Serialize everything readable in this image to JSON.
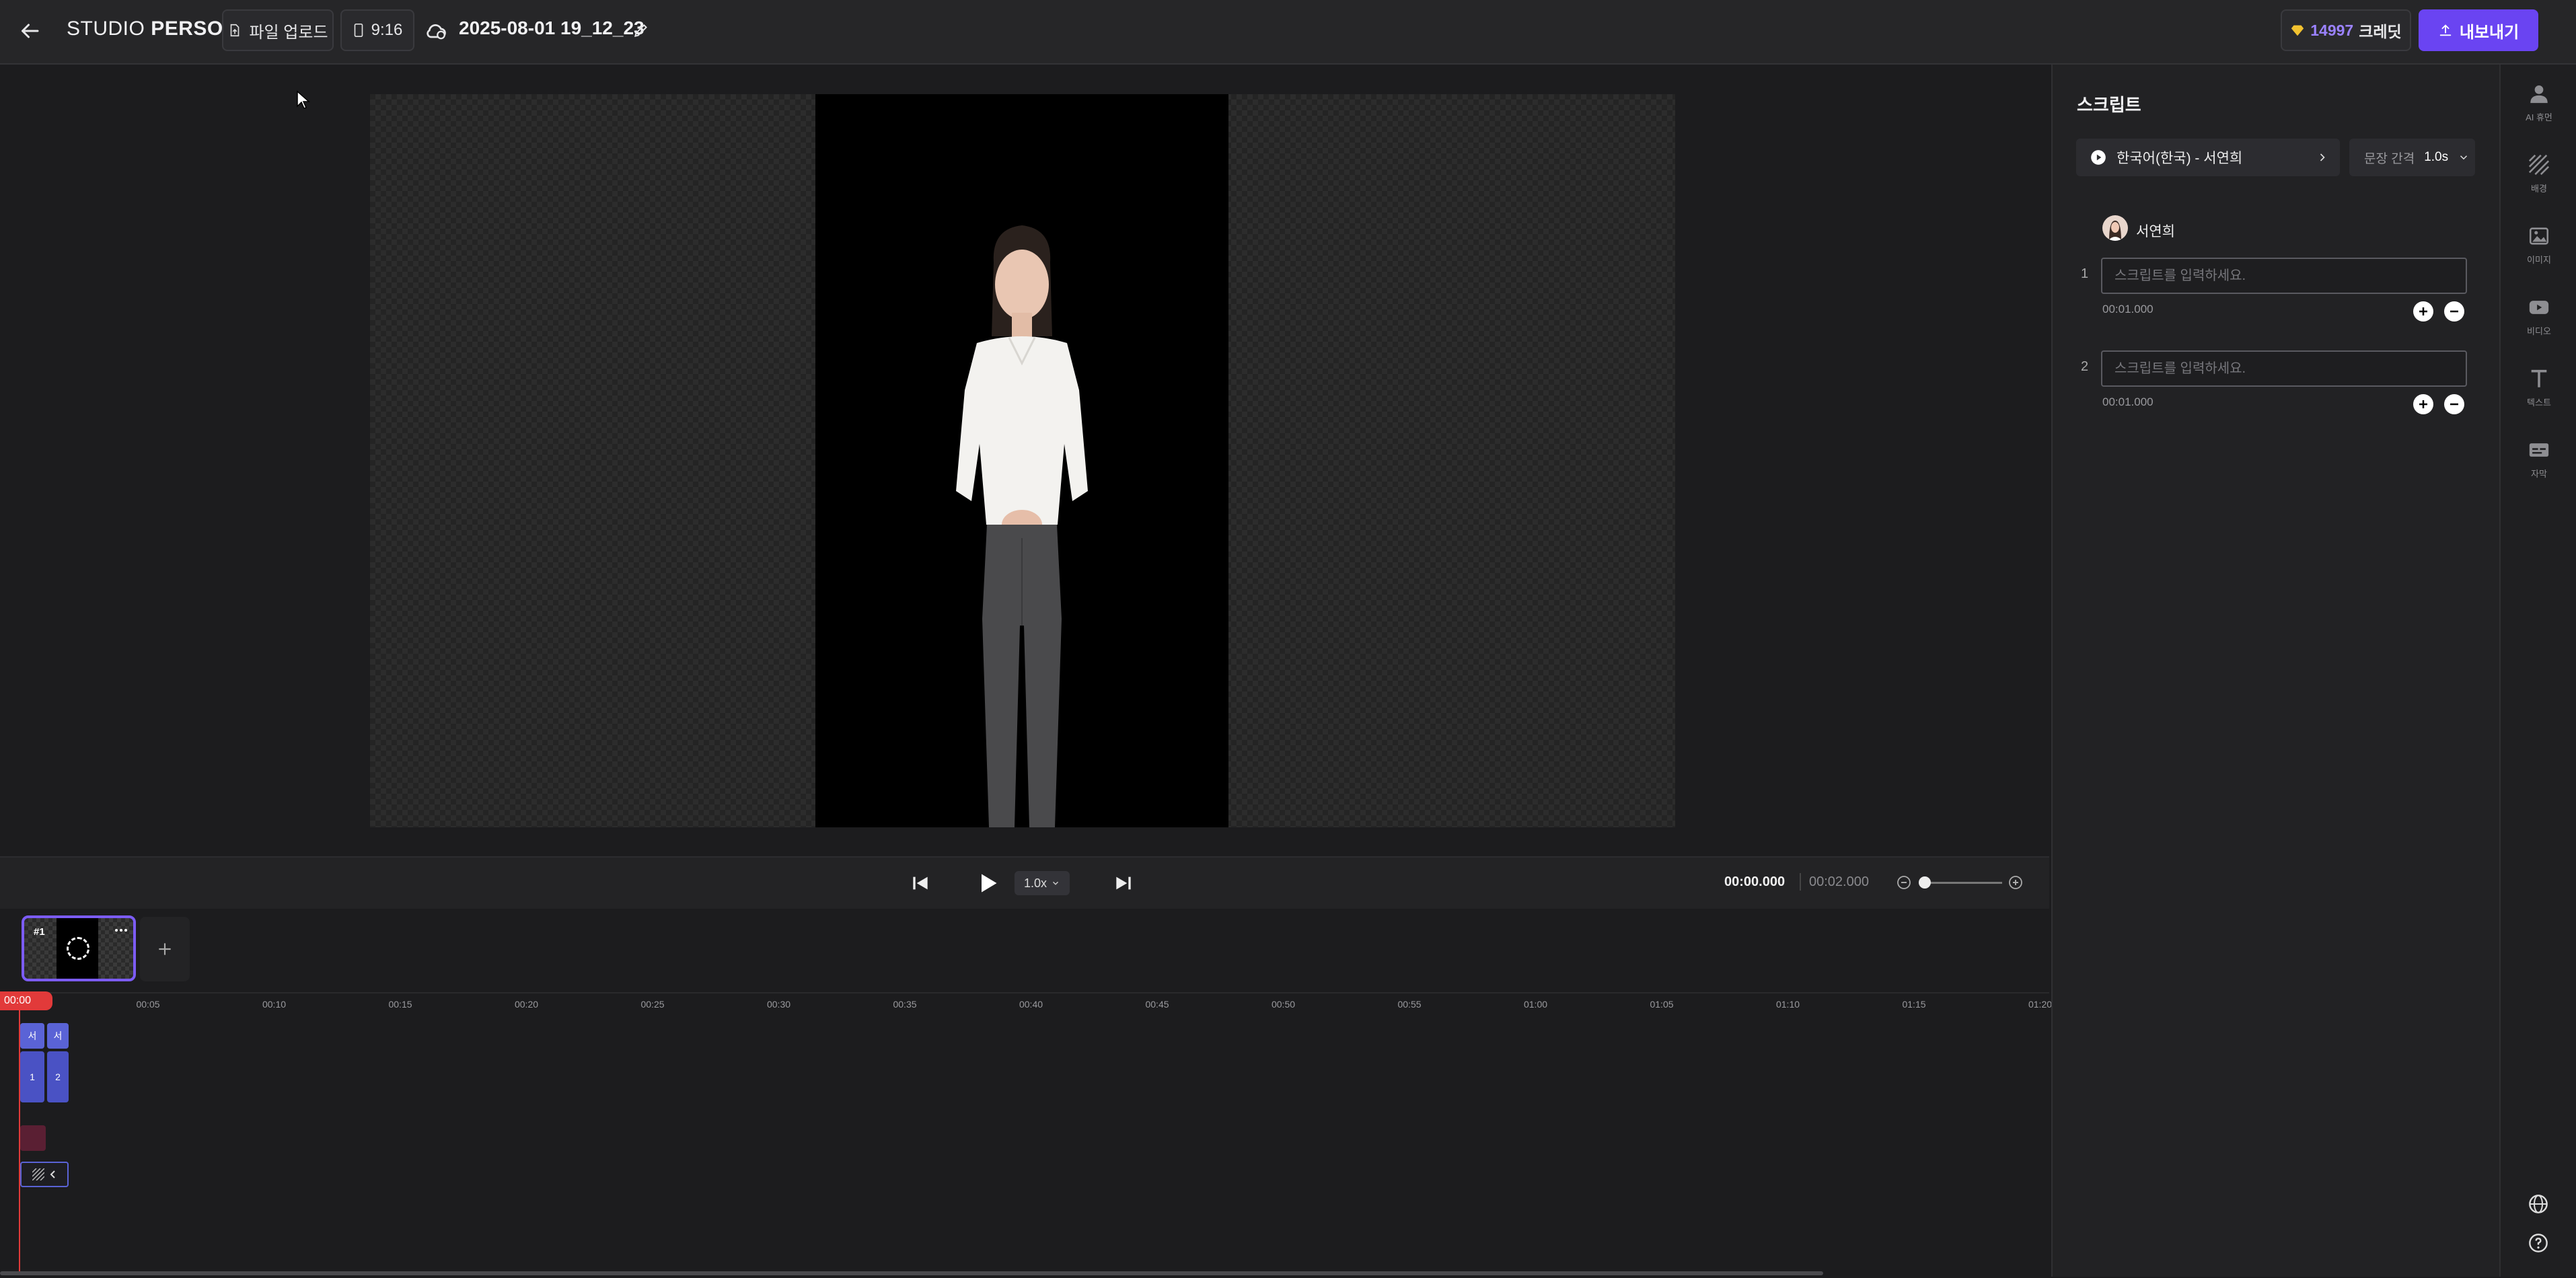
{
  "header": {
    "brand_light": "STUDIO",
    "brand_bold": "PERSO",
    "upload_label": "파일 업로드",
    "ratio_label": "9:16",
    "project_title": "2025-08-01 19_12_23",
    "credits_value": "14997",
    "credits_label": "크레딧",
    "export_label": "내보내기"
  },
  "player": {
    "speed": "1.0x",
    "current_time": "00:00.000",
    "total_time": "00:02.000"
  },
  "scenes": [
    {
      "label": "#1"
    }
  ],
  "timeline": {
    "playhead": "00:00",
    "ticks": [
      "00:05",
      "00:10",
      "00:15",
      "00:20",
      "00:25",
      "00:30",
      "00:35",
      "00:40",
      "00:45",
      "00:50",
      "00:55",
      "01:00",
      "01:05",
      "01:10",
      "01:15",
      "01:20"
    ],
    "clips": [
      {
        "top": "서",
        "bottom": "1"
      },
      {
        "top": "서",
        "bottom": "2"
      }
    ]
  },
  "script_panel": {
    "title": "스크립트",
    "voice": "한국어(한국) - 서연희",
    "gap_label": "문장 간격",
    "gap_value": "1.0s",
    "speaker": "서연희",
    "rows": [
      {
        "num": "1",
        "placeholder": "스크립트를 입력하세요.",
        "duration": "00:01.000"
      },
      {
        "num": "2",
        "placeholder": "스크립트를 입력하세요.",
        "duration": "00:01.000"
      }
    ]
  },
  "right_rail": {
    "items": [
      {
        "icon": "person-icon",
        "label": "AI 휴먼"
      },
      {
        "icon": "background-icon",
        "label": "배경"
      },
      {
        "icon": "image-icon",
        "label": "이미지"
      },
      {
        "icon": "video-icon",
        "label": "비디오"
      },
      {
        "icon": "text-icon",
        "label": "텍스트"
      },
      {
        "icon": "subtitle-icon",
        "label": "자막"
      }
    ]
  },
  "colors": {
    "accent": "#6a44f2",
    "playhead": "#e23a3a",
    "clip": "#5a63d6",
    "credit_gem": "#f2c230"
  }
}
